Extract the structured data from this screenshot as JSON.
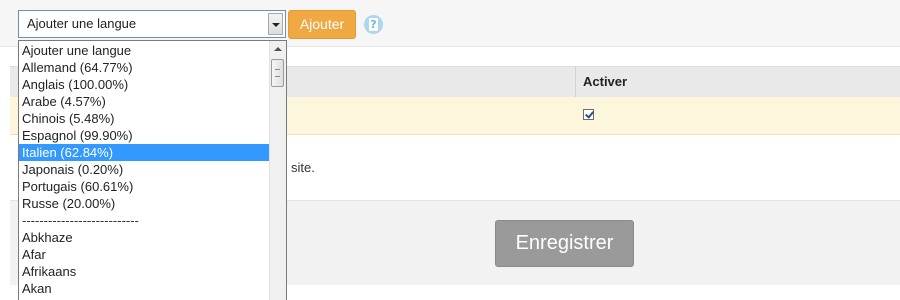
{
  "language_select": {
    "selected_label": "Ajouter une langue",
    "options": [
      {
        "label": "Ajouter une langue"
      },
      {
        "label": "Allemand (64.77%)"
      },
      {
        "label": "Anglais (100.00%)"
      },
      {
        "label": "Arabe (4.57%)"
      },
      {
        "label": "Chinois (5.48%)"
      },
      {
        "label": "Espagnol (99.90%)"
      },
      {
        "label": "Italien (62.84%)"
      },
      {
        "label": "Japonais (0.20%)"
      },
      {
        "label": "Portugais (60.61%)"
      },
      {
        "label": "Russe (20.00%)"
      },
      {
        "label": "---------------------------"
      },
      {
        "label": "Abkhaze"
      },
      {
        "label": "Afar"
      },
      {
        "label": "Afrikaans"
      },
      {
        "label": "Akan"
      }
    ],
    "highlighted_index": 6
  },
  "toolbar": {
    "add_label": "Ajouter",
    "help_icon": "help-icon"
  },
  "table": {
    "columns": [
      "Activer"
    ],
    "rows": [
      {
        "activer_checked": true
      }
    ]
  },
  "info": {
    "text": "site."
  },
  "footer": {
    "save_label": "Enregistrer"
  },
  "colors": {
    "add_button": "#f0a843",
    "save_button": "#9a9a9a",
    "row_highlight": "#fbf6dc",
    "option_selected": "#3399ff"
  }
}
